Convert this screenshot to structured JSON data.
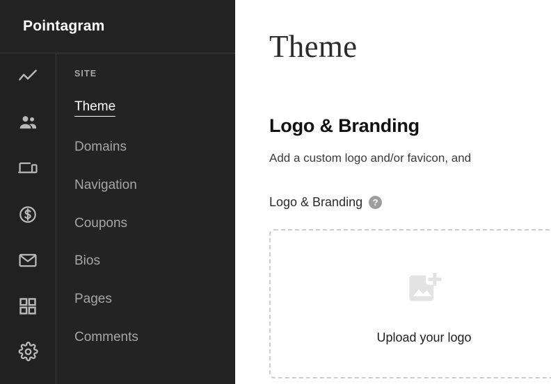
{
  "brand": {
    "name": "Pointagram"
  },
  "icon_rail": {
    "items": [
      {
        "icon": "analytics-line-chart-icon"
      },
      {
        "icon": "users-people-icon"
      },
      {
        "icon": "devices-laptop-phone-icon"
      },
      {
        "icon": "dollar-circle-icon"
      },
      {
        "icon": "mail-envelope-icon"
      },
      {
        "icon": "grid-apps-icon"
      },
      {
        "icon": "gear-settings-icon"
      }
    ]
  },
  "sidebar": {
    "section_label": "SITE",
    "items": [
      {
        "label": "Theme",
        "active": true
      },
      {
        "label": "Domains",
        "active": false
      },
      {
        "label": "Navigation",
        "active": false
      },
      {
        "label": "Coupons",
        "active": false
      },
      {
        "label": "Bios",
        "active": false
      },
      {
        "label": "Pages",
        "active": false
      },
      {
        "label": "Comments",
        "active": false
      }
    ]
  },
  "main": {
    "page_title": "Theme",
    "section_title": "Logo & Branding",
    "section_desc": "Add a custom logo and/or favicon, and",
    "field_label": "Logo & Branding",
    "help_glyph": "?",
    "upload": {
      "text": "Upload your logo"
    }
  },
  "colors": {
    "sidebar_bg": "#232323",
    "rail_bg": "#212121",
    "divider": "#3a3a3a",
    "active_text": "#ffffff",
    "muted_text": "#a6a6a6",
    "dropzone_border": "#cfcfcf",
    "help_bg": "#9e9e9e"
  }
}
